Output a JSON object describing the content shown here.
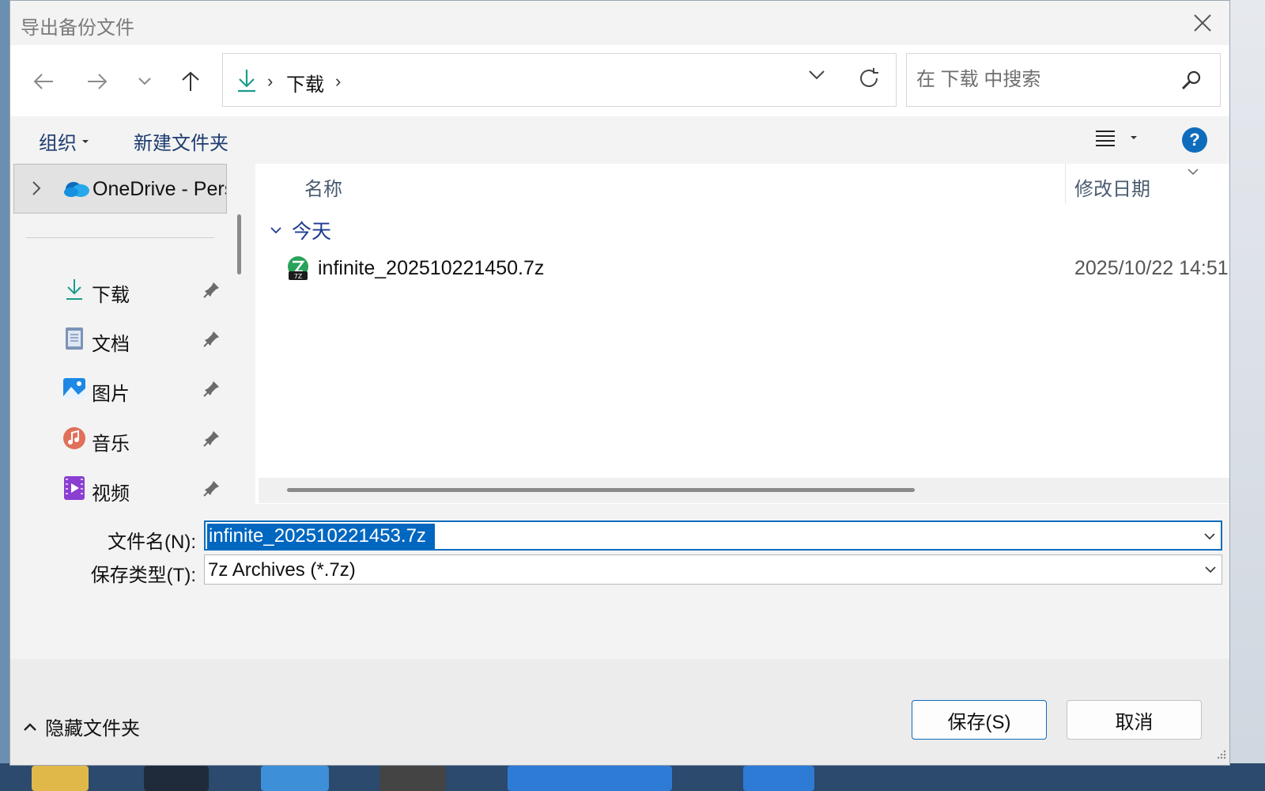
{
  "dialog": {
    "title": "导出备份文件"
  },
  "nav": {
    "breadcrumb": [
      "下载"
    ],
    "search_placeholder": "在 下载 中搜索"
  },
  "toolbar": {
    "organize_label": "组织",
    "new_folder_label": "新建文件夹"
  },
  "sidebar": {
    "onedrive_label": "OneDrive - Pers",
    "items": [
      {
        "label": "下载",
        "icon": "download-icon"
      },
      {
        "label": "文档",
        "icon": "document-icon"
      },
      {
        "label": "图片",
        "icon": "pictures-icon"
      },
      {
        "label": "音乐",
        "icon": "music-icon"
      },
      {
        "label": "视频",
        "icon": "video-icon"
      }
    ]
  },
  "file_list": {
    "columns": {
      "name": "名称",
      "date": "修改日期"
    },
    "group_label": "今天",
    "files": [
      {
        "name": "infinite_202510221450.7z",
        "date": "2025/10/22 14:51",
        "icon": "7z-archive-icon"
      }
    ]
  },
  "form": {
    "filename_label": "文件名(N):",
    "filename_value": "infinite_202510221453.7z",
    "filetype_label": "保存类型(T):",
    "filetype_value": "7z Archives (*.7z)"
  },
  "footer": {
    "hide_folders_label": "隐藏文件夹",
    "save_label": "保存(S)",
    "cancel_label": "取消"
  },
  "colors": {
    "accent": "#0f6cbd",
    "selection": "#0067c0",
    "group_text": "#1d3b8f"
  }
}
